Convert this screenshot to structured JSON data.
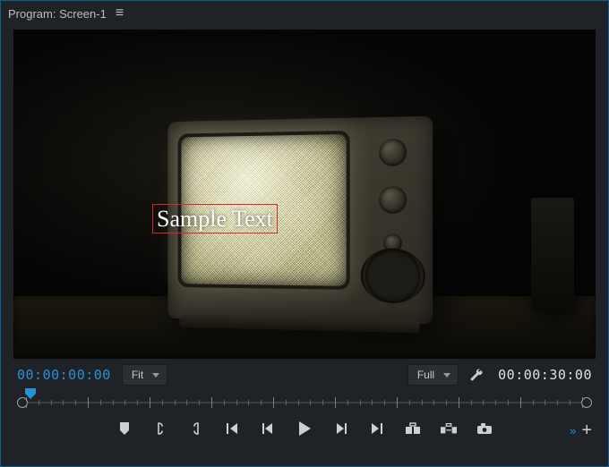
{
  "header": {
    "title": "Program: Screen-1"
  },
  "canvas": {
    "overlay_text": "Sample Text"
  },
  "status": {
    "timecode_current": "00:00:00:00",
    "timecode_duration": "00:00:30:00",
    "zoom_label": "Fit",
    "resolution_label": "Full"
  },
  "icons": {
    "menu": "≡",
    "expand": "»",
    "plus": "+"
  }
}
